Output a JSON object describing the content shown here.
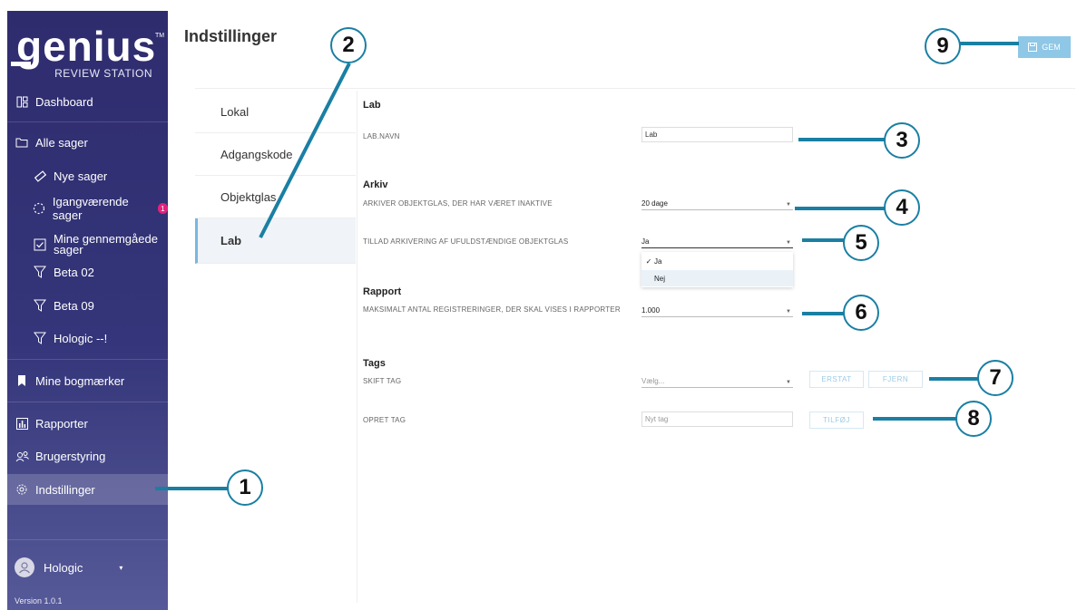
{
  "logo": {
    "word": "genius",
    "tm": "TM",
    "subtitle": "REVIEW STATION"
  },
  "sidebar": {
    "dashboard": "Dashboard",
    "all_cases": "Alle sager",
    "new_cases": "Nye sager",
    "in_progress": "Igangværende sager",
    "in_progress_badge": "1",
    "my_reviewed": "Mine gennemgåede sager",
    "beta02": "Beta 02",
    "beta09": "Beta 09",
    "hologic_filter": "Hologic --!",
    "bookmarks": "Mine bogmærker",
    "reports": "Rapporter",
    "users": "Brugerstyring",
    "settings": "Indstillinger",
    "user_name": "Hologic",
    "version": "Version 1.0.1"
  },
  "header": {
    "title": "Indstillinger",
    "save_label": "GEM"
  },
  "subnav": [
    "Lokal",
    "Adgangskode",
    "Objektglas",
    "Lab"
  ],
  "lab": {
    "title": "Lab",
    "name_label": "LAB.NAVN",
    "name_value": "Lab"
  },
  "archive": {
    "title": "Arkiv",
    "inactive_label": "ARKIVER OBJEKTGLAS, DER HAR VÆRET INAKTIVE",
    "inactive_value": "20 dage",
    "incomplete_label": "TILLAD ARKIVERING AF UFULDSTÆNDIGE OBJEKTGLAS",
    "incomplete_value": "Ja",
    "incomplete_options": [
      "Ja",
      "Nej"
    ]
  },
  "report": {
    "title": "Rapport",
    "max_label": "MAKSIMALT ANTAL REGISTRERINGER, DER SKAL VISES I RAPPORTER",
    "max_value": "1.000"
  },
  "tags": {
    "title": "Tags",
    "change_label": "SKIFT TAG",
    "change_placeholder": "Vælg...",
    "replace_btn": "ERSTAT",
    "remove_btn": "FJERN",
    "create_label": "OPRET TAG",
    "create_placeholder": "Nyt tag",
    "add_btn": "TILFØJ"
  },
  "callouts": [
    "1",
    "2",
    "3",
    "4",
    "5",
    "6",
    "7",
    "8",
    "9"
  ],
  "colors": {
    "sidebar": "#2f2c6e",
    "accent": "#1a7fa3",
    "save": "#8fc7e6"
  }
}
